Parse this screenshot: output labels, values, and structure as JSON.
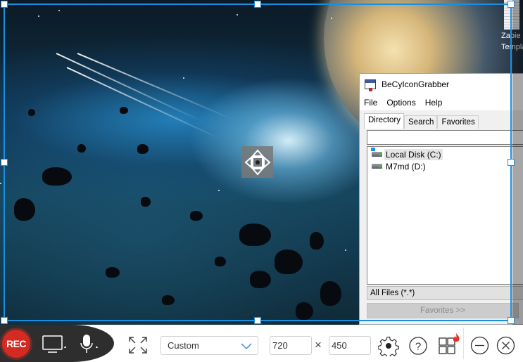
{
  "desktop": {
    "icon_label_line1": "Zapie",
    "icon_label_line2": "Templa"
  },
  "app_window": {
    "title": "BeCyIconGrabber",
    "menu": [
      "File",
      "Options",
      "Help"
    ],
    "tabs": [
      {
        "label": "Directory",
        "active": true
      },
      {
        "label": "Search",
        "active": false
      },
      {
        "label": "Favorites",
        "active": false
      }
    ],
    "path_value": "",
    "drives": [
      {
        "label": "Local Disk (C:)",
        "selected": true,
        "icon": "system-drive-icon"
      },
      {
        "label": "M7md (D:)",
        "selected": false,
        "icon": "drive-icon"
      }
    ],
    "file_filter": "All Files (*.*)",
    "favorites_button": "Favorites >>"
  },
  "capture": {
    "move_handle_icon": "move-arrows-icon",
    "selection_color": "#1a8fe0"
  },
  "toolbar": {
    "rec_label": "REC",
    "rec_color": "#d32a22",
    "screen_icon": "monitor-icon",
    "mic_icon": "microphone-icon",
    "fullscreen_icon": "expand-icon",
    "size_preset": "Custom",
    "width_value": "720",
    "height_value": "450",
    "times_symbol": "×",
    "settings_icon": "gear-icon",
    "help_icon": "help-icon",
    "apps_icon": "apps-grid-icon",
    "minimize_icon": "minimize-icon",
    "close_icon": "close-icon"
  }
}
